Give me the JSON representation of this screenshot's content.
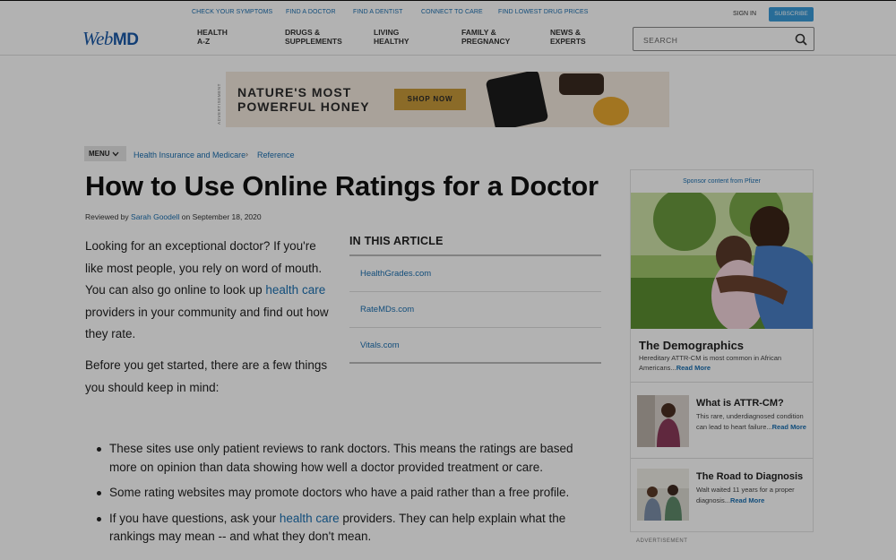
{
  "header": {
    "utility_links": [
      "CHECK YOUR SYMPTOMS",
      "FIND A DOCTOR",
      "FIND A DENTIST",
      "CONNECT TO CARE",
      "FIND LOWEST DRUG PRICES"
    ],
    "sign_in": "SIGN IN",
    "subscribe": "SUBSCRIBE",
    "logo": {
      "web": "Web",
      "md": "MD"
    },
    "nav": [
      {
        "line1": "HEALTH",
        "line2": "A-Z"
      },
      {
        "line1": "DRUGS &",
        "line2": "SUPPLEMENTS"
      },
      {
        "line1": "LIVING",
        "line2": "HEALTHY"
      },
      {
        "line1": "FAMILY &",
        "line2": "PREGNANCY"
      },
      {
        "line1": "NEWS &",
        "line2": "EXPERTS"
      }
    ],
    "search_placeholder": "SEARCH"
  },
  "ad_banner": {
    "label": "ADVERTISEMENT",
    "headline_line1": "NATURE'S MOST",
    "headline_line2": "POWERFUL HONEY",
    "cta": "SHOP NOW"
  },
  "breadcrumb": {
    "menu": "MENU",
    "items": [
      "Health Insurance and Medicare",
      "Reference"
    ]
  },
  "article": {
    "title": "How to Use Online Ratings for a Doctor",
    "byline_prefix": "Reviewed by",
    "reviewer": "Sarah Goodell",
    "byline_suffix": "on September 18, 2020",
    "intro_part1": "Looking for an exceptional doctor? If you're like most people, you rely on word of mouth. You can also go online to look up ",
    "intro_link": "health care",
    "intro_part2": " providers in your community and find out how they rate.",
    "intro2": "Before you get started, there are a few things you should keep in mind:",
    "bullets": [
      {
        "text": "These sites use only patient reviews to rank doctors. This means the ratings are based more on opinion than data showing how well a doctor provided treatment or care."
      },
      {
        "text": "Some rating websites may promote doctors who have a paid rather than a free profile."
      },
      {
        "pre": "If you have questions, ask your ",
        "link": "health care",
        "post": " providers. They can help explain what the rankings may mean -- and what they don't mean."
      }
    ]
  },
  "in_this_article": {
    "heading": "IN THIS ARTICLE",
    "items": [
      "HealthGrades.com",
      "RateMDs.com",
      "Vitals.com"
    ]
  },
  "sidebar": {
    "sponsor": "Sponsor content from Pfizer",
    "feature": {
      "title": "The Demographics",
      "text": "Hereditary ATTR-CM is most common in African Americans...",
      "read_more": "Read More"
    },
    "cards": [
      {
        "title": "What is ATTR-CM?",
        "text": "This rare, underdiagnosed condition can lead to heart failure...",
        "read_more": "Read More"
      },
      {
        "title": "The Road to Diagnosis",
        "text": "Walt waited 11 years for a proper diagnosis...",
        "read_more": "Read More"
      }
    ],
    "ad_label": "ADVERTISEMENT"
  }
}
